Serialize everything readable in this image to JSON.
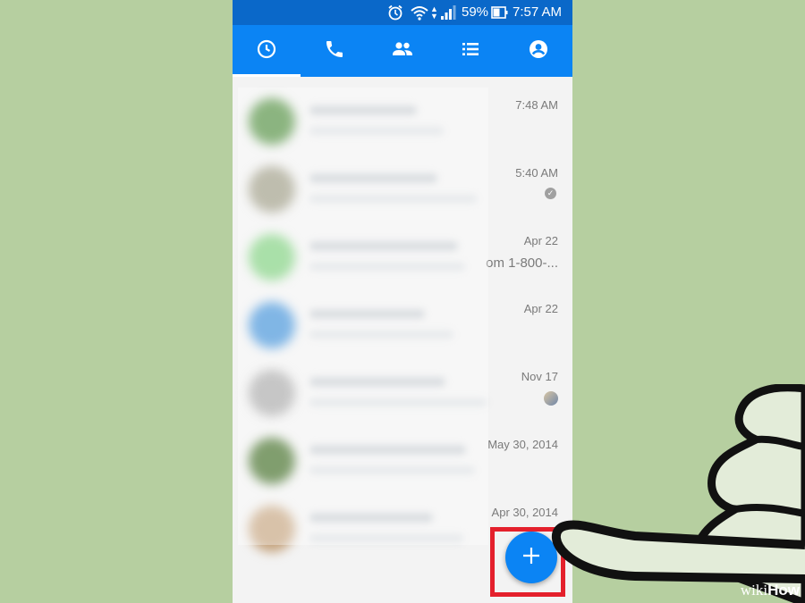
{
  "status_bar": {
    "battery": "59%",
    "time": "7:57 AM",
    "icons": [
      "alarm-icon",
      "wifi-icon",
      "signal-icon",
      "battery-icon"
    ]
  },
  "tabs": [
    {
      "name": "recent",
      "icon": "clock-icon",
      "active": true
    },
    {
      "name": "calls",
      "icon": "phone-icon",
      "active": false
    },
    {
      "name": "groups",
      "icon": "people-icon",
      "active": false
    },
    {
      "name": "list",
      "icon": "list-icon",
      "active": false
    },
    {
      "name": "profile",
      "icon": "profile-icon",
      "active": false
    }
  ],
  "conversations": [
    {
      "time": "7:48 AM",
      "snippet": "",
      "avatar_color": "#4e8d3c"
    },
    {
      "time": "5:40 AM",
      "snippet": "",
      "avatar_color": "#9c9a83",
      "status": "read-check"
    },
    {
      "time": "Apr 22",
      "snippet": "om 1-800-...",
      "avatar_color": "#7ccf7b"
    },
    {
      "time": "Apr 22",
      "snippet": "",
      "avatar_color": "#3d8fd8"
    },
    {
      "time": "Nov 17",
      "snippet": "",
      "avatar_color": "#a8a8a8",
      "status": "seen-avatar"
    },
    {
      "time": "May 30, 2014",
      "snippet": "",
      "avatar_color": "#3d6a21"
    },
    {
      "time": "Apr 30, 2014",
      "snippet": "",
      "avatar_color": "#c4a27c"
    }
  ],
  "fab": {
    "label": "+",
    "icon": "plus-icon"
  },
  "watermark": {
    "prefix": "wiki",
    "suffix": "How"
  },
  "colors": {
    "statusbar": "#0a68c9",
    "appbar": "#0b84f4",
    "highlight": "#e4202c",
    "background": "#b6cfa0"
  }
}
